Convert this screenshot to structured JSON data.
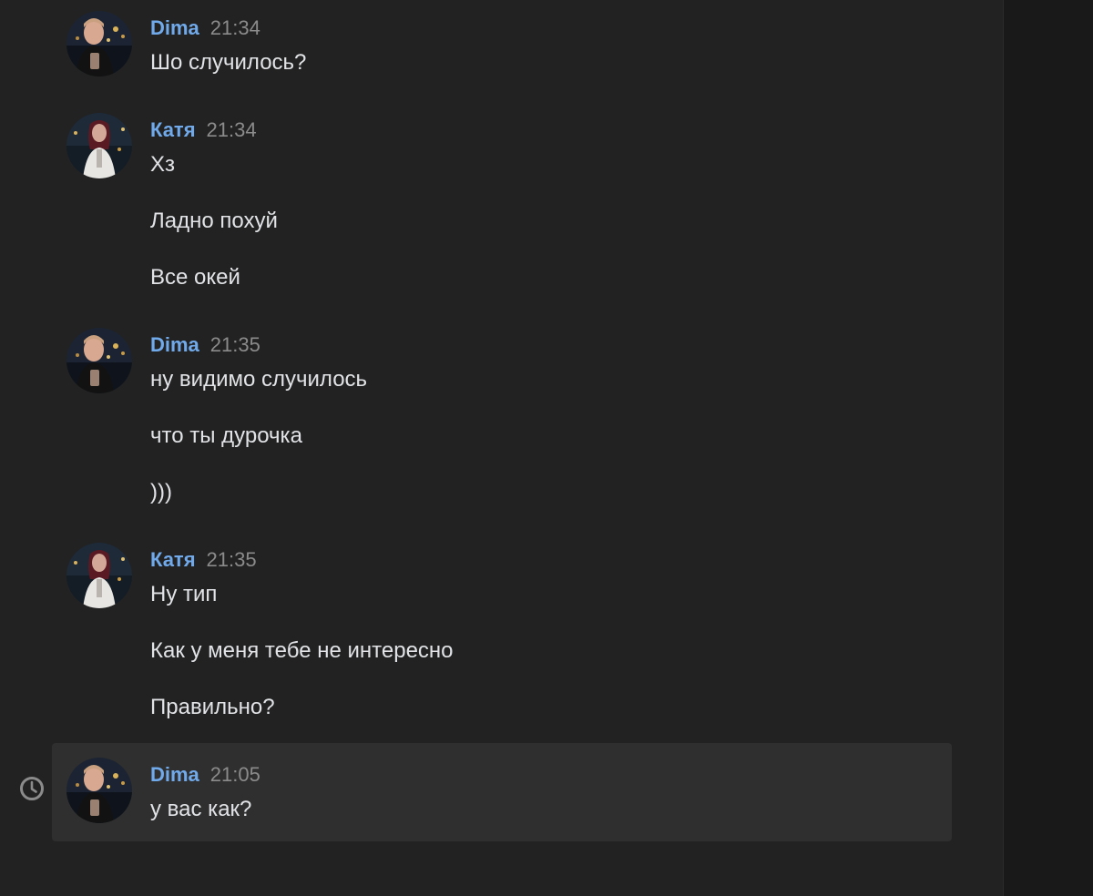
{
  "messages": [
    {
      "author": "Dima",
      "time": "21:34",
      "avatar": "dima-avatar",
      "lines": [
        "Шо случилось?"
      ]
    },
    {
      "author": "Катя",
      "time": "21:34",
      "avatar": "katya-avatar",
      "lines": [
        "Хз",
        "Ладно похуй",
        "Все окей"
      ]
    },
    {
      "author": "Dima",
      "time": "21:35",
      "avatar": "dima-avatar",
      "lines": [
        "ну видимо случилось",
        "что ты дурочка",
        ")))"
      ]
    },
    {
      "author": "Катя",
      "time": "21:35",
      "avatar": "katya-avatar",
      "lines": [
        "Ну тип",
        "Как у меня тебе не интересно",
        "Правильно?"
      ]
    },
    {
      "author": "Dima",
      "time": "21:05",
      "avatar": "dima-avatar",
      "status_icon": "clock-icon",
      "lines": [
        "у вас как?"
      ]
    }
  ],
  "colors": {
    "background": "#222222",
    "author": "#71aaeb",
    "time": "#8b8b8b",
    "text": "#e1e3e6",
    "highlight": "#2f2f2f"
  }
}
